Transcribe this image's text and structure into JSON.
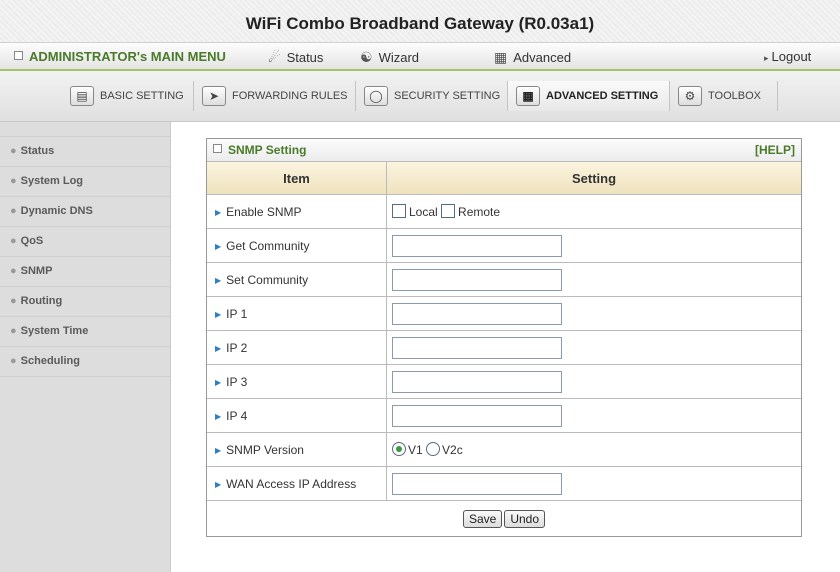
{
  "header": {
    "title": "WiFi Combo Broadband Gateway (R0.03a1)"
  },
  "menu": {
    "admin": "ADMINISTRATOR's MAIN MENU",
    "status": "Status",
    "wizard": "Wizard",
    "advanced": "Advanced",
    "logout": "Logout"
  },
  "tabs": [
    {
      "label": "BASIC SETTING",
      "icon": "folder-icon"
    },
    {
      "label": "FORWARDING RULES",
      "icon": "forward-icon"
    },
    {
      "label": "SECURITY SETTING",
      "icon": "security-icon"
    },
    {
      "label": "ADVANCED SETTING",
      "icon": "advanced-icon"
    },
    {
      "label": "TOOLBOX",
      "icon": "toolbox-icon"
    }
  ],
  "sidebar": {
    "items": [
      {
        "label": "Status"
      },
      {
        "label": "System Log"
      },
      {
        "label": "Dynamic DNS"
      },
      {
        "label": "QoS"
      },
      {
        "label": "SNMP"
      },
      {
        "label": "Routing"
      },
      {
        "label": "System Time"
      },
      {
        "label": "Scheduling"
      }
    ]
  },
  "panel": {
    "title": "SNMP Setting",
    "help": "[HELP]",
    "col_item": "Item",
    "col_setting": "Setting",
    "rows": {
      "enable": "Enable SNMP",
      "local": "Local",
      "remote": "Remote",
      "get_community": "Get Community",
      "set_community": "Set Community",
      "ip1": "IP 1",
      "ip2": "IP 2",
      "ip3": "IP 3",
      "ip4": "IP 4",
      "version": "SNMP Version",
      "v1": "V1",
      "v2c": "V2c",
      "wan_access": "WAN Access IP Address"
    },
    "values": {
      "get_community": "",
      "set_community": "",
      "ip1": "",
      "ip2": "",
      "ip3": "",
      "ip4": "",
      "wan_access": "",
      "local_checked": false,
      "remote_checked": false,
      "version_selected": "V1"
    },
    "save": "Save",
    "undo": "Undo"
  },
  "colors": {
    "accent_green": "#9fc46a",
    "header_tan": "#efe2bd",
    "sidebar_bg": "#dddddd"
  }
}
